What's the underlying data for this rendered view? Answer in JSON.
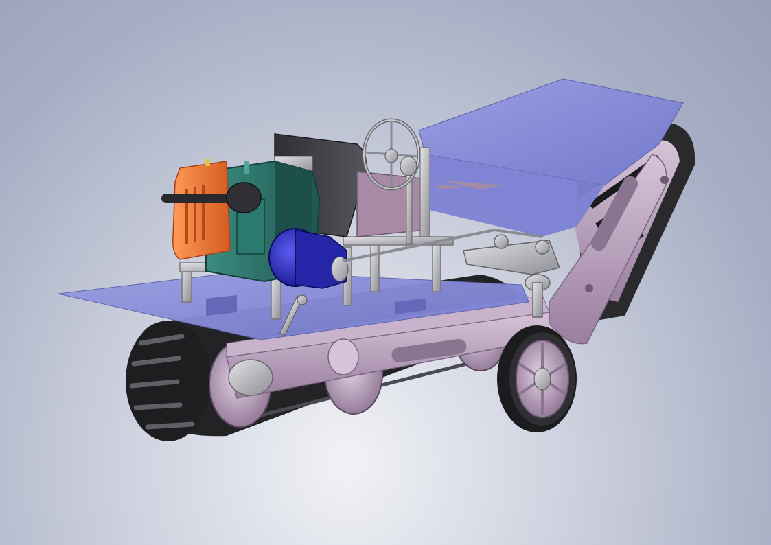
{
  "colors": {
    "background_light": "#eef0f5",
    "background_dark": "#9aa2b9",
    "sheet": "#8489d6",
    "frame": "#b39ab8",
    "track": "#2b2b2e",
    "engine_body": "#2d6e66",
    "radiator": "#f07a3a",
    "gearbox": "#2a2bb0",
    "seat": "#3a3a40",
    "metal": "#b7b7bd",
    "tire": "#1c1c1f"
  },
  "icons": {
    "steering_wheel": "steering-wheel-icon",
    "radiator": "radiator-icon",
    "gearbox": "gearbox-icon",
    "wheel": "wheel-icon"
  }
}
